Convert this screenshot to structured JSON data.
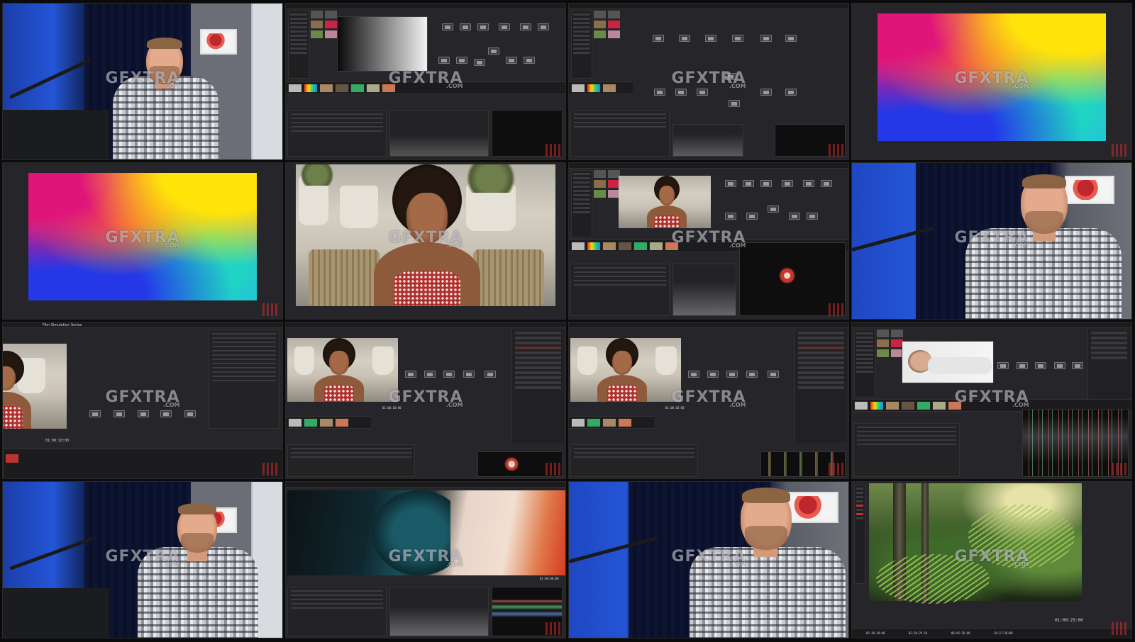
{
  "watermark": {
    "text": "GFXTRA",
    "sub": ".COM"
  },
  "tiles": {
    "t1": {
      "kind": "presenter"
    },
    "t2": {
      "kind": "resolve-color-page",
      "viewer": "grayscale ramp"
    },
    "t3": {
      "kind": "resolve-node-graph"
    },
    "t4": {
      "kind": "gradient-viewer"
    },
    "t5": {
      "kind": "gradient-viewer"
    },
    "t6": {
      "kind": "portrait-viewer"
    },
    "t7": {
      "kind": "resolve-color-page",
      "viewer": "portrait"
    },
    "t8": {
      "kind": "presenter"
    },
    "t9": {
      "kind": "resolve-settings",
      "title": "Film Simulation Series",
      "timecode": "01:00:10:00"
    },
    "t10": {
      "kind": "resolve-color-page",
      "timecode": "01:00:10:00"
    },
    "t11": {
      "kind": "resolve-color-page",
      "timecode": "01:00:10:00"
    },
    "t12": {
      "kind": "resolve-color-page",
      "viewer": "reclining portrait"
    },
    "t13": {
      "kind": "presenter"
    },
    "t14": {
      "kind": "cinematic-viewer",
      "timecode": "01:00:00:00"
    },
    "t15": {
      "kind": "presenter"
    },
    "t16": {
      "kind": "forest-viewer",
      "timecode": "01:00:25:00",
      "bottom_timecodes": [
        "02:36:10:00",
        "02:36:25:14",
        "06:05:36:00",
        "18:37:36:00"
      ]
    }
  }
}
